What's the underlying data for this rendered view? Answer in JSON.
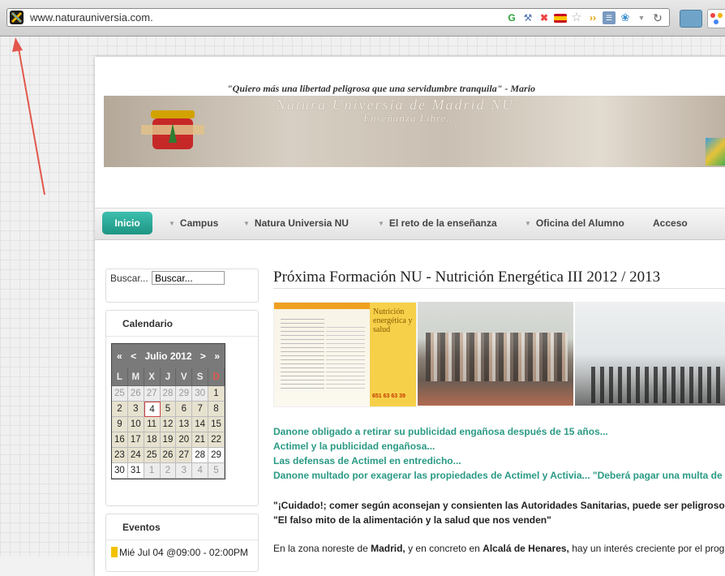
{
  "browser": {
    "url": "www.naturauniversia.com.",
    "icons": [
      "refresh-green-icon",
      "wrench-icon",
      "joomla-icon",
      "spanish-flag-icon",
      "star-icon",
      "chevron-icon",
      "rss-icon",
      "twitter-icon",
      "dropdown-icon",
      "reload-icon"
    ]
  },
  "site": {
    "motto": "\"Quiero más una libertad peligrosa que una servidumbre tranquila\" - Mario",
    "banner_title": "Natura Universia de Madrid NU",
    "banner_sub": "Enseñanza Libre..."
  },
  "nav": {
    "home": "Inicio",
    "items": [
      "Campus",
      "Natura Universia NU",
      "El reto de la enseñanza",
      "Oficina del Alumno",
      "Acceso"
    ]
  },
  "sidebar": {
    "search_label": "Buscar...",
    "search_placeholder": "Buscar...",
    "calendar_title": "Calendario",
    "calendar": {
      "prev_year": "«",
      "prev_month": "<",
      "month_label": "Julio 2012",
      "next_month": ">",
      "next_year": "»",
      "weekdays": [
        "L",
        "M",
        "X",
        "J",
        "V",
        "S",
        "D"
      ]
    },
    "events_title": "Eventos",
    "event_item": "Mié Jul 04 @09:00 - 02:00PM"
  },
  "main": {
    "article_title": "Próxima Formación NU - Nutrición Energética III 2012 / 2013",
    "poster_heading": "Nutrición energética y salud",
    "poster_phone": "651 63 63 39",
    "links": [
      "Danone obligado a retirar su publicidad engañosa después de 15 años...",
      "Actimel y la publicidad engañosa...",
      "Las defensas de Actimel en entredicho...",
      "Danone multado por exagerar las propiedades de Actimel y Activia... \"Deberá pagar una multa de"
    ],
    "quote1": "\"¡Cuidado!; comer según aconsejan y consienten las Autoridades Sanitarias, puede ser peligroso",
    "quote2": "\"El falso mito de la alimentación y la salud que nos venden\"",
    "para_part1": "En la zona noreste de ",
    "para_bold1": "Madrid,",
    "para_part2": " y en concreto en ",
    "para_bold2": "Alcalá de Henares,",
    "para_part3": " hay un interés creciente por el prog"
  },
  "colors": {
    "accent": "#2a9a84",
    "nav_home": "#24a08e",
    "arrow": "#e2574c"
  }
}
